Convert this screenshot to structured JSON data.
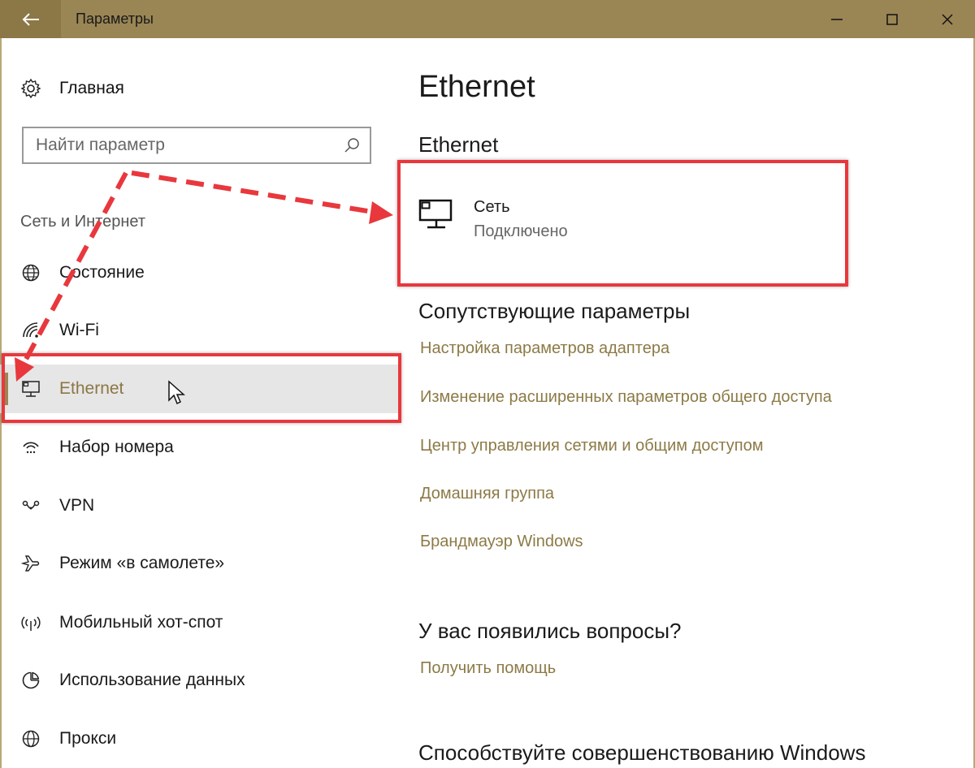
{
  "window": {
    "title": "Параметры"
  },
  "sidebar": {
    "home_label": "Главная",
    "search_placeholder": "Найти параметр",
    "section_label": "Сеть и Интернет",
    "items": [
      {
        "label": "Состояние",
        "icon": "globe-icon"
      },
      {
        "label": "Wi-Fi",
        "icon": "wifi-icon"
      },
      {
        "label": "Ethernet",
        "icon": "ethernet-icon",
        "selected": true
      },
      {
        "label": "Набор номера",
        "icon": "dialup-icon"
      },
      {
        "label": "VPN",
        "icon": "vpn-icon"
      },
      {
        "label": "Режим «в самолете»",
        "icon": "airplane-icon"
      },
      {
        "label": "Мобильный хот-спот",
        "icon": "hotspot-icon"
      },
      {
        "label": "Использование данных",
        "icon": "data-usage-icon"
      },
      {
        "label": "Прокси",
        "icon": "proxy-globe-icon"
      }
    ]
  },
  "main": {
    "page_title": "Ethernet",
    "section_title": "Ethernet",
    "network": {
      "name": "Сеть",
      "status": "Подключено"
    },
    "related_title": "Сопутствующие параметры",
    "related_links": [
      "Настройка параметров адаптера",
      "Изменение расширенных параметров общего доступа",
      "Центр управления сетями и общим доступом",
      "Домашняя группа",
      "Брандмауэр Windows"
    ],
    "questions_title": "У вас появились вопросы?",
    "help_link": "Получить помощь",
    "improve_title": "Способствуйте совершенствованию Windows"
  },
  "colors": {
    "accent": "#9a8554",
    "link": "#8c7a46",
    "annotation": "#e8383d"
  }
}
